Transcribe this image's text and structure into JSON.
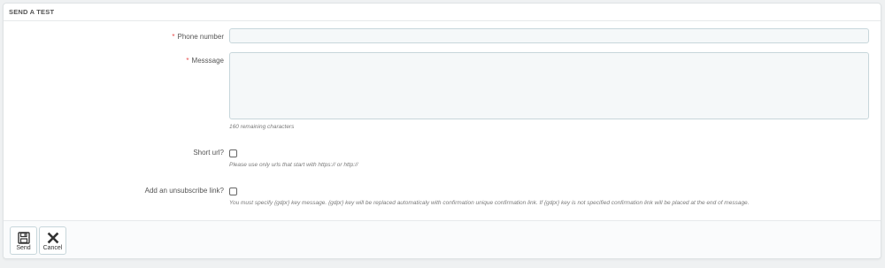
{
  "panel": {
    "title": "SEND A TEST"
  },
  "form": {
    "phone": {
      "required_mark": "*",
      "label": "Phone number",
      "value": "",
      "placeholder": ""
    },
    "message": {
      "required_mark": "*",
      "label": "Messsage",
      "value": "",
      "help": "160 remaining characters"
    },
    "short_url": {
      "label": "Short url?",
      "checked": false,
      "help": "Please use only urls that start with https:// or http://"
    },
    "unsubscribe": {
      "label": "Add an unsubscribe link?",
      "checked": false,
      "help": "You must specify {gdpr} key message. {gdpr} key will be replaced automaticaly with confirmation unique confirmation link. If {gdpr} key is not specified confirmation link will be placed at the end of message."
    }
  },
  "footer": {
    "send_label": "Send",
    "cancel_label": "Cancel",
    "send_icon": "floppy-disk-icon",
    "cancel_icon": "close-icon"
  },
  "colors": {
    "required": "#e84e4e",
    "input_bg": "#f5f8f9",
    "input_border": "#c7d6db"
  }
}
